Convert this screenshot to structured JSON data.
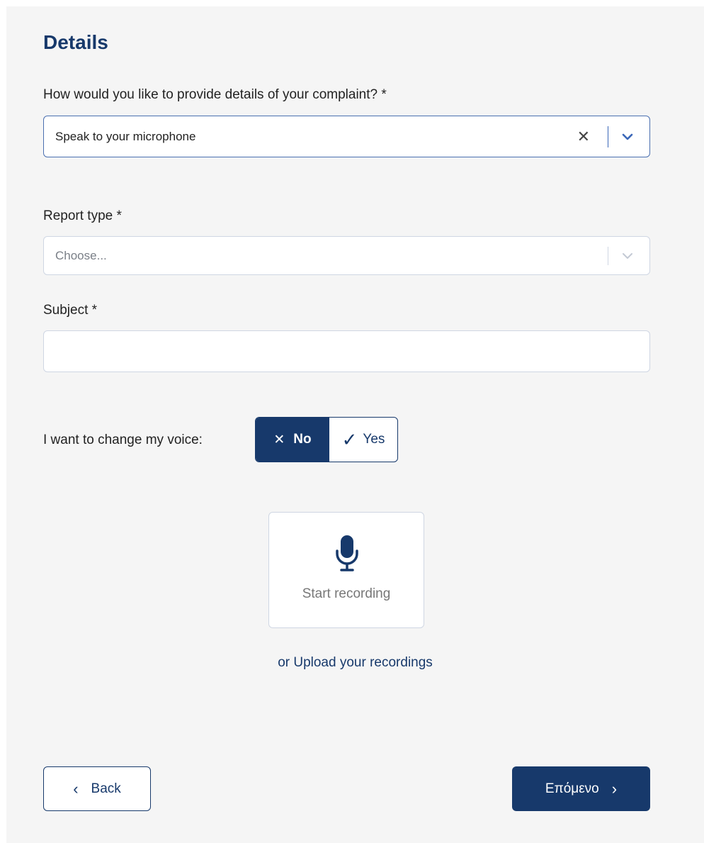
{
  "form": {
    "title": "Details",
    "method": {
      "label": "How would you like to provide details of your complaint? *",
      "value": "Speak to your microphone"
    },
    "report_type": {
      "label": "Report type *",
      "placeholder": "Choose..."
    },
    "subject": {
      "label": "Subject *",
      "value": ""
    },
    "voice_change": {
      "label": "I want to change my voice:",
      "no_label": "No",
      "yes_label": "Yes",
      "selected": "No"
    },
    "recording": {
      "start_label": "Start recording",
      "upload_label": "or Upload your recordings"
    }
  },
  "nav": {
    "back_label": "Back",
    "next_label": "Επόμενο"
  },
  "colors": {
    "primary": "#17396b",
    "accent": "#3a67b8",
    "background": "#f5f5f5"
  },
  "icons": [
    "clear-icon",
    "chevron-down-icon",
    "x-icon",
    "check-icon",
    "microphone-icon",
    "chevron-left-icon",
    "chevron-right-icon"
  ]
}
